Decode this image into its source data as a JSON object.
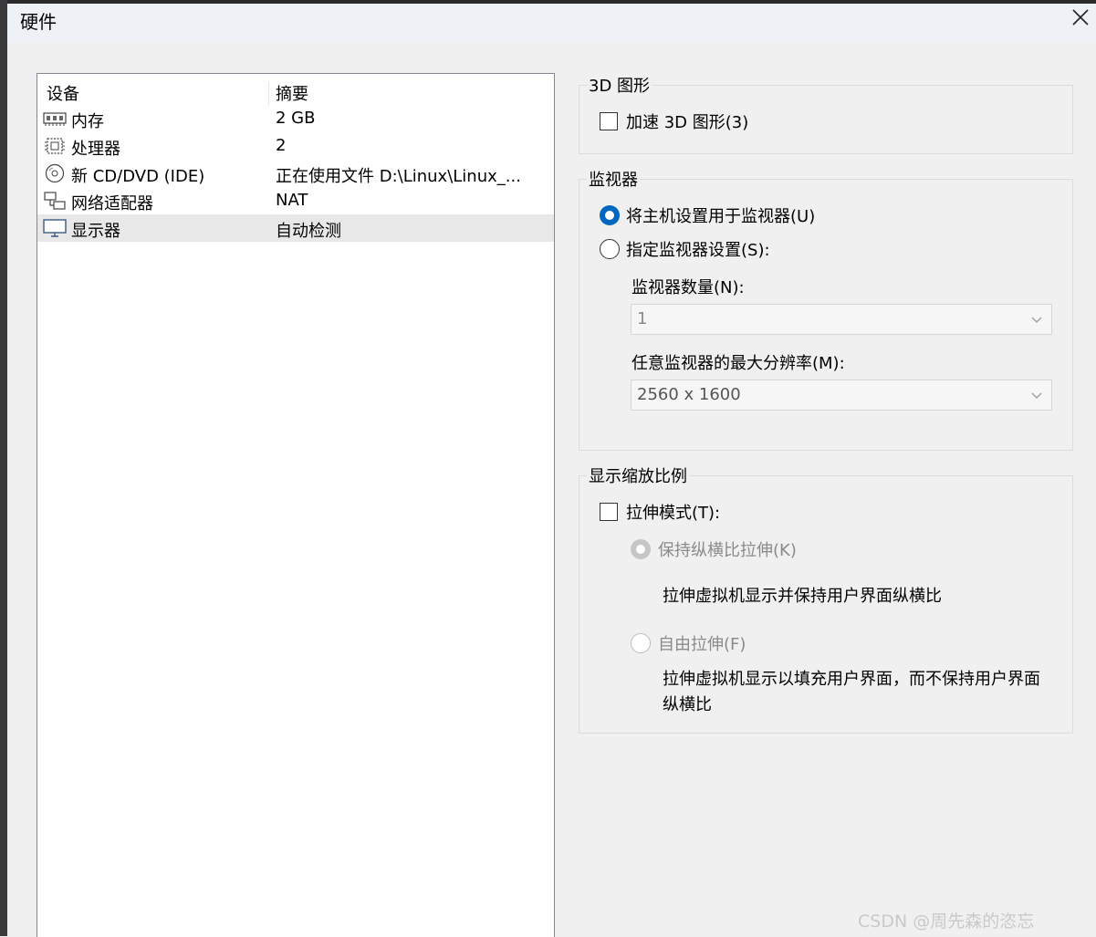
{
  "window": {
    "title": "硬件"
  },
  "device_list": {
    "headers": {
      "device": "设备",
      "summary": "摘要"
    },
    "rows": [
      {
        "icon": "memory-icon",
        "name": "内存",
        "summary": "2 GB"
      },
      {
        "icon": "processor-icon",
        "name": "处理器",
        "summary": "2"
      },
      {
        "icon": "cd-dvd-icon",
        "name": "新 CD/DVD (IDE)",
        "summary": "正在使用文件 D:\\Linux\\Linux_..."
      },
      {
        "icon": "network-adapter-icon",
        "name": "网络适配器",
        "summary": "NAT"
      },
      {
        "icon": "display-icon",
        "name": "显示器",
        "summary": "自动检测",
        "selected": true
      }
    ]
  },
  "graphics_3d": {
    "legend": "3D 图形",
    "accelerate_label": "加速 3D 图形(3)",
    "accelerate_checked": false
  },
  "monitors": {
    "legend": "监视器",
    "use_host_label": "将主机设置用于监视器(U)",
    "specify_label": "指定监视器设置(S):",
    "selected": "use_host",
    "count_label": "监视器数量(N):",
    "count_value": "1",
    "max_res_label": "任意监视器的最大分辨率(M):",
    "max_res_value": "2560 x 1600"
  },
  "display_scaling": {
    "legend": "显示缩放比例",
    "stretch_label": "拉伸模式(T):",
    "stretch_checked": false,
    "keep_aspect_label": "保持纵横比拉伸(K)",
    "keep_aspect_desc": "拉伸虚拟机显示并保持用户界面纵横比",
    "free_stretch_label": "自由拉伸(F)",
    "free_stretch_desc": "拉伸虚拟机显示以填充用户界面，而不保持用户界面纵横比"
  },
  "watermark": "CSDN @周先森的恣忘",
  "colors": {
    "accent": "#0067c0",
    "selection": "#e8e8e8",
    "disabled": "#8a8a8a"
  }
}
